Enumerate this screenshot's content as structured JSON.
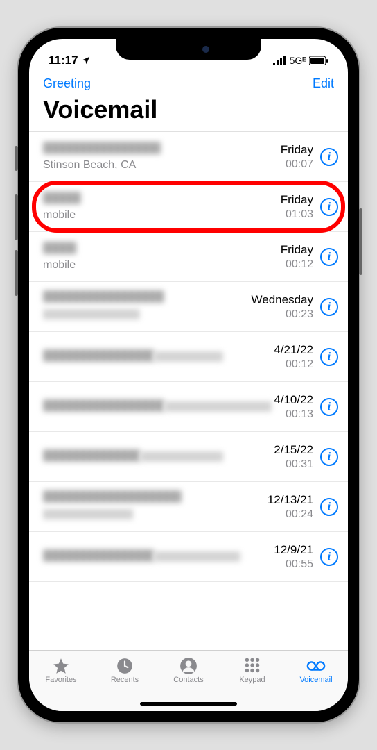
{
  "status": {
    "time": "11:17",
    "network_label": "5Gᴱ"
  },
  "nav": {
    "greeting": "Greeting",
    "edit": "Edit"
  },
  "title": "Voicemail",
  "voicemails": [
    {
      "name_blurred": true,
      "name_w": 170,
      "sub": "Stinson Beach, CA",
      "sub_blurred": false,
      "date": "Friday",
      "duration": "00:07",
      "highlighted": false
    },
    {
      "name_blurred": true,
      "name_w": 55,
      "sub": "mobile",
      "sub_blurred": false,
      "date": "Friday",
      "duration": "01:03",
      "highlighted": true
    },
    {
      "name_blurred": true,
      "name_w": 48,
      "sub": "mobile",
      "sub_blurred": false,
      "date": "Friday",
      "duration": "00:12",
      "highlighted": false
    },
    {
      "name_blurred": true,
      "name_w": 175,
      "sub_blurred": true,
      "sub_w": 140,
      "date": "Wednesday",
      "duration": "00:23",
      "highlighted": false
    },
    {
      "name_blurred": true,
      "name_w": 160,
      "sub_blurred": true,
      "sub_w": 100,
      "date": "4/21/22",
      "duration": "00:12",
      "highlighted": false
    },
    {
      "name_blurred": true,
      "name_w": 175,
      "sub_blurred": true,
      "sub_w": 155,
      "date": "4/10/22",
      "duration": "00:13",
      "highlighted": false
    },
    {
      "name_blurred": true,
      "name_w": 140,
      "sub_blurred": true,
      "sub_w": 120,
      "date": "2/15/22",
      "duration": "00:31",
      "highlighted": false
    },
    {
      "name_blurred": true,
      "name_w": 200,
      "sub_blurred": true,
      "sub_w": 130,
      "date": "12/13/21",
      "duration": "00:24",
      "highlighted": false
    },
    {
      "name_blurred": true,
      "name_w": 160,
      "sub_blurred": true,
      "sub_w": 125,
      "date": "12/9/21",
      "duration": "00:55",
      "highlighted": false
    }
  ],
  "tabs": {
    "favorites": "Favorites",
    "recents": "Recents",
    "contacts": "Contacts",
    "keypad": "Keypad",
    "voicemail": "Voicemail"
  }
}
